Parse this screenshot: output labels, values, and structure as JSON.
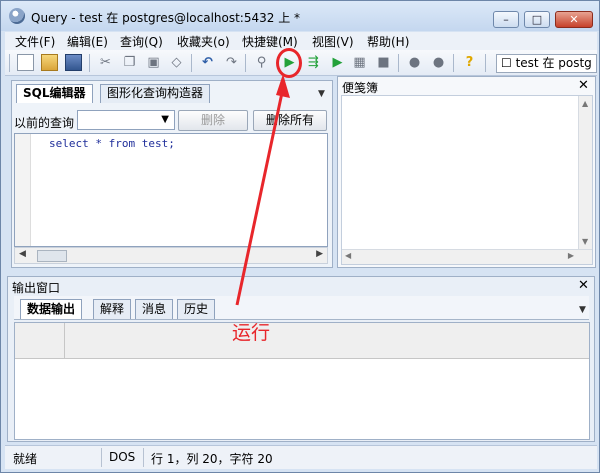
{
  "window": {
    "title": "Query - test 在  postgres@localhost:5432 上 *",
    "minimize_glyph": "–",
    "maximize_glyph": "□",
    "close_glyph": "✕"
  },
  "menu": [
    "文件(F)",
    "编辑(E)",
    "查询(Q)",
    "收藏夹(o)",
    "快捷键(M)",
    "视图(V)",
    "帮助(H)"
  ],
  "toolbar": {
    "database_checkbox_label": "test 在  postg",
    "icons": {
      "cut": "✂",
      "copy": "❐",
      "paste": "▣",
      "clear": "◇",
      "undo": "↶",
      "redo": "↷",
      "find": "⚲",
      "run": "▶",
      "explain": "⇶",
      "run_to_file": "▶",
      "explain_analyze": "▦",
      "stop": "■",
      "cancel": "●",
      "commit": "●",
      "help": "?"
    }
  },
  "editor_panel": {
    "tabs": [
      "SQL编辑器",
      "图形化查询构造器"
    ],
    "previous_queries_label": "以前的查询",
    "delete_label": "删除",
    "delete_all_label": "删除所有",
    "sql_text": "select * from test;"
  },
  "notes_panel": {
    "title": "便笺簿",
    "close_glyph": "✕"
  },
  "output_panel": {
    "title": "输出窗口",
    "close_glyph": "✕",
    "tabs": [
      "数据输出",
      "解释",
      "消息",
      "历史"
    ]
  },
  "status_bar": {
    "state": "就绪",
    "line_ending": "DOS",
    "position": "行 1，列 20，字符 20"
  },
  "annotation": {
    "label": "运行",
    "color": "#e8262b"
  }
}
